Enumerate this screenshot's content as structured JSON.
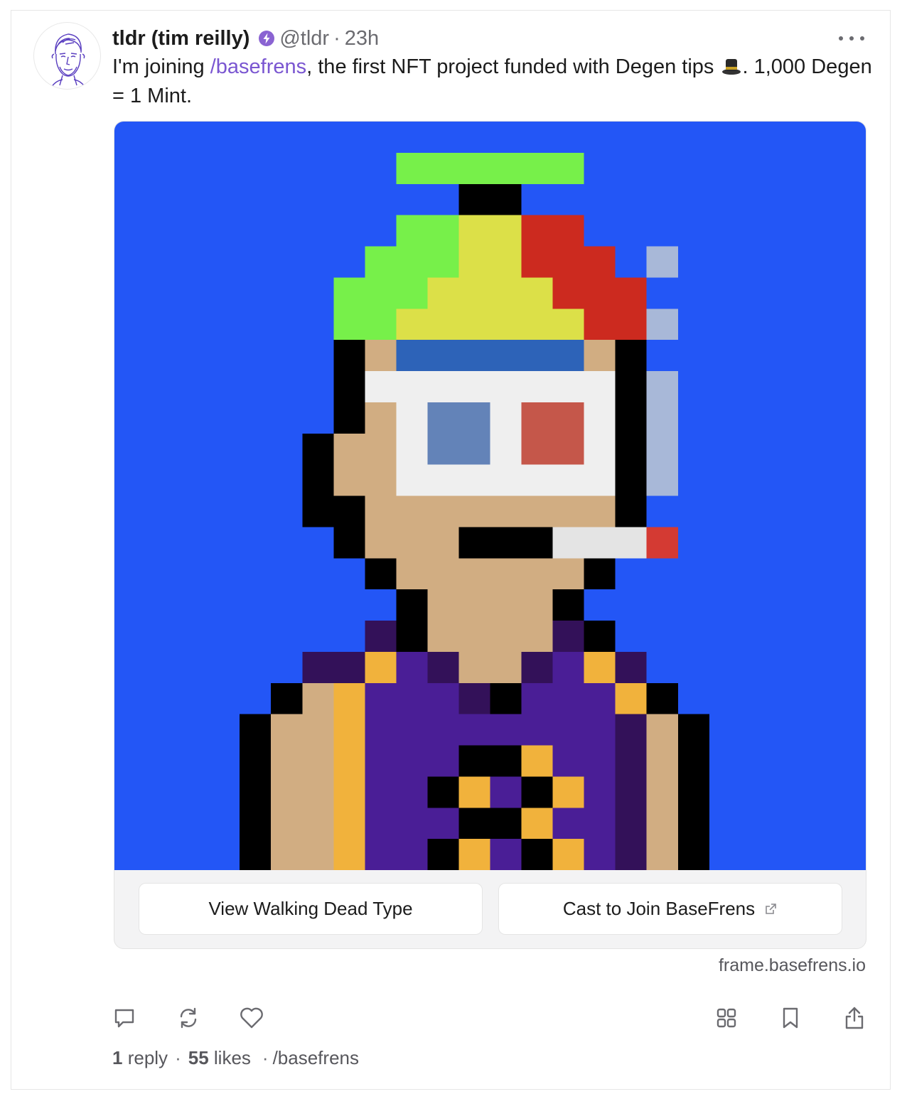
{
  "post": {
    "display_name": "tldr (tim reilly)",
    "handle": "@tldr",
    "separator": "·",
    "time_ago": "23h",
    "text_before_link": "I'm joining ",
    "channel_link": "/basefrens",
    "text_after_link": ", the first NFT project funded with Degen tips ",
    "emoji": "top-hat-emoji",
    "text_end": ". 1,000 Degen = 1 Mint.",
    "verified_badge": "power-badge-icon",
    "badge_color": "#8a63d2"
  },
  "frame": {
    "image_description_colors": {
      "background": "#2356f6",
      "skin": "#d1ad82",
      "shirt": "#4a1e96",
      "accent": "#f1b23c"
    },
    "buttons": [
      {
        "label": "View Walking Dead Type"
      },
      {
        "label": "Cast to Join BaseFrens",
        "icon": "external-link-icon"
      }
    ],
    "domain": "frame.basefrens.io"
  },
  "actions": {
    "icons": [
      "reply-icon",
      "recast-icon",
      "like-icon",
      "grid-icon",
      "bookmark-icon",
      "share-icon"
    ]
  },
  "stats": {
    "replies_count": "1",
    "replies_label": "reply",
    "likes_count": "55",
    "likes_label": "likes",
    "separator": "·",
    "channel": "/basefrens"
  }
}
